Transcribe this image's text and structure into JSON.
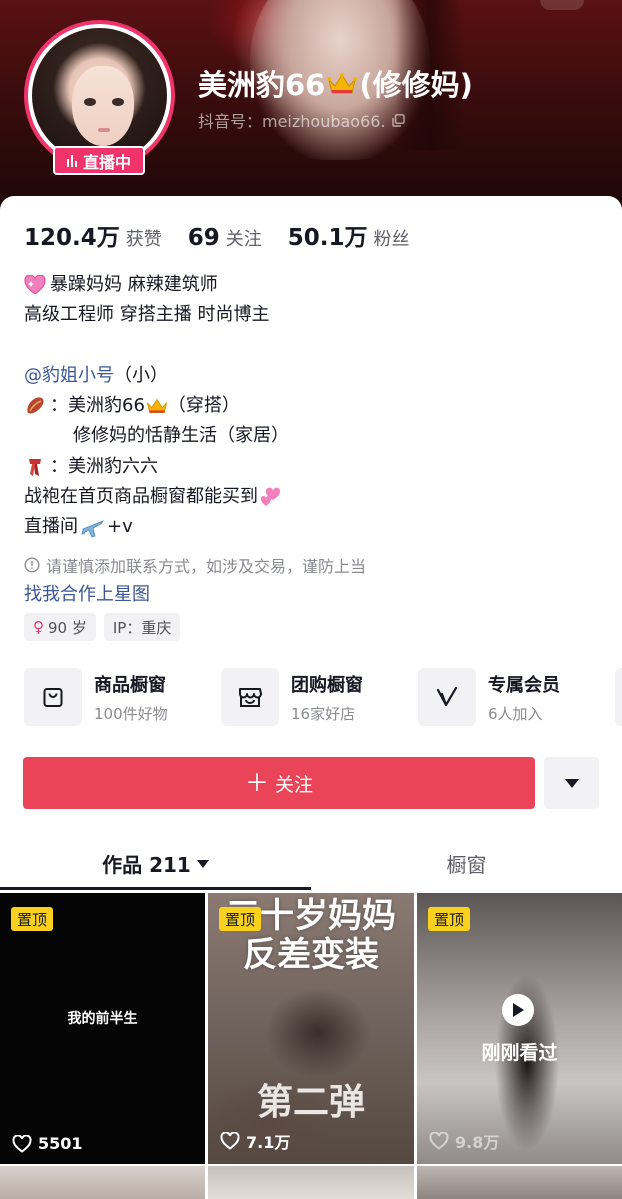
{
  "profile": {
    "nickname_prefix": "美洲豹66",
    "nickname_suffix": "(修修妈)",
    "douyin_id": "抖音号：meizhoubao66.",
    "live_label": "直播中"
  },
  "stats": [
    {
      "value": "120.4万",
      "label": "获赞"
    },
    {
      "value": "69",
      "label": "关注"
    },
    {
      "value": "50.1万",
      "label": "粉丝"
    }
  ],
  "bio": {
    "line1": "暴躁妈妈 麻辣建筑师",
    "line2": "高级工程师 穿搭主播 时尚博主",
    "line3_link": "@豹姐小号",
    "line3_rest": "（小）",
    "line4_a": "：美洲豹66",
    "line4_b": "（穿搭）",
    "line5": "修修妈的恬静生活（家居）",
    "line6": "：美洲豹六六",
    "line7": "战袍在首页商品橱窗都能买到",
    "line8_a": "直播间",
    "line8_b": "+v"
  },
  "warning": "请谨慎添加联系方式，如涉及交易，谨防上当",
  "star_link": "找我合作上星图",
  "tags": {
    "age": "90 岁",
    "ip": "IP：重庆"
  },
  "shortcuts": [
    {
      "title": "商品橱窗",
      "sub": "100件好物",
      "icon": "shopping-bag-icon"
    },
    {
      "title": "团购橱窗",
      "sub": "16家好店",
      "icon": "storefront-icon"
    },
    {
      "title": "专属会员",
      "sub": "6人加入",
      "icon": "vip-v-icon"
    }
  ],
  "actions": {
    "follow": "关注",
    "follow_plus": "＋"
  },
  "tabs": {
    "works": "作品 211",
    "showcase": "橱窗"
  },
  "videos": {
    "pin_label": "置顶",
    "v1_caption": "我的前半生",
    "v1_likes": "5501",
    "v2_title_1": "三十岁妈妈",
    "v2_title_2": "反差变装",
    "v2_sub": "第二弹",
    "v2_likes": "7.1万",
    "v3_recent": "刚刚看过",
    "v3_likes": "9.8万"
  },
  "colors": {
    "accent": "#ea4458",
    "live": "#f0336a",
    "link": "#3a5795",
    "pin": "#f8d11f"
  }
}
